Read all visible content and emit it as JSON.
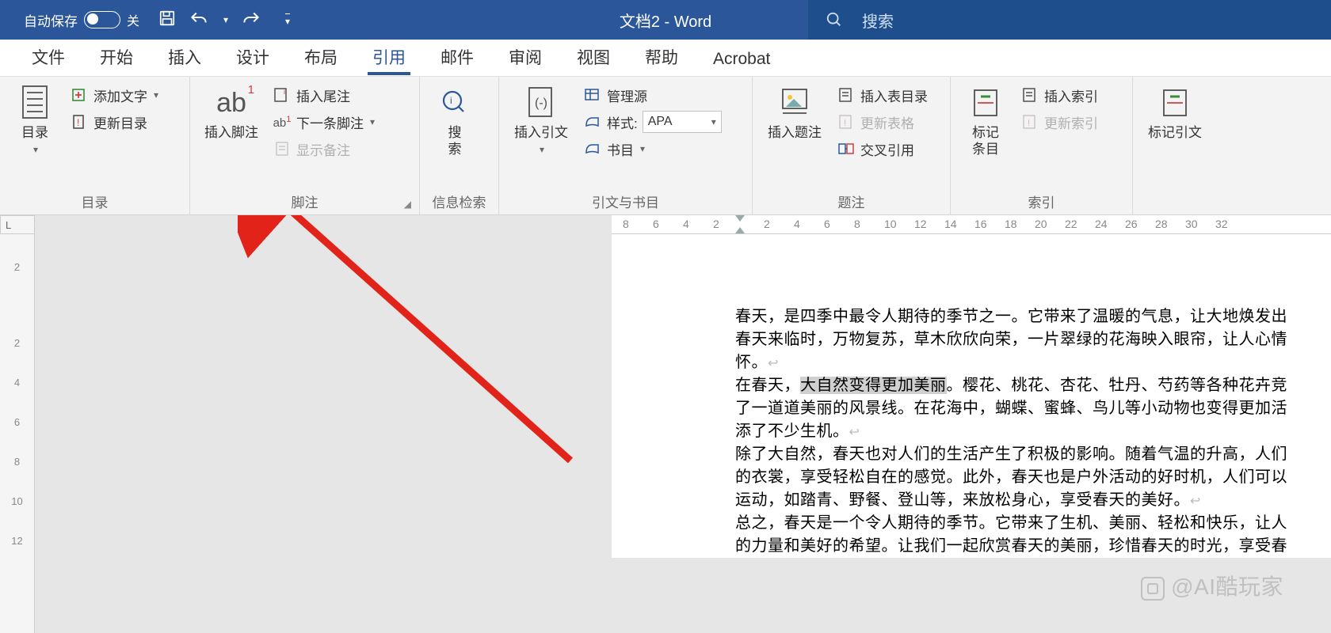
{
  "titlebar": {
    "autosave": "自动保存",
    "toggle_state": "关",
    "doc_title": "文档2  -  Word",
    "search_placeholder": "搜索"
  },
  "tabs": [
    "文件",
    "开始",
    "插入",
    "设计",
    "布局",
    "引用",
    "邮件",
    "审阅",
    "视图",
    "帮助",
    "Acrobat"
  ],
  "active_tab_index": 5,
  "ribbon": {
    "groups": [
      {
        "label": "目录",
        "big": [
          {
            "label": "目录",
            "icon": "toc-icon",
            "drop": true
          }
        ],
        "small": [
          {
            "label": "添加文字",
            "icon": "add-text-icon",
            "drop": true
          },
          {
            "label": "更新目录",
            "icon": "update-toc-icon"
          }
        ]
      },
      {
        "label": "脚注",
        "launcher": true,
        "big": [
          {
            "label": "插入脚注",
            "icon": "footnote-icon"
          }
        ],
        "small": [
          {
            "label": "插入尾注",
            "icon": "endnote-icon"
          },
          {
            "label": "下一条脚注",
            "icon": "next-footnote-icon",
            "drop": true
          },
          {
            "label": "显示备注",
            "icon": "show-notes-icon",
            "disabled": true
          }
        ]
      },
      {
        "label": "信息检索",
        "big": [
          {
            "label": "搜\n索",
            "icon": "search-icon"
          }
        ]
      },
      {
        "label": "引文与书目",
        "big": [
          {
            "label": "插入引文",
            "icon": "citation-icon",
            "drop": true
          }
        ],
        "small": [
          {
            "label": "管理源",
            "icon": "manage-sources-icon"
          },
          {
            "label": "样式:",
            "icon": "style-icon",
            "select": "APA"
          },
          {
            "label": "书目",
            "icon": "bibliography-icon",
            "drop": true
          }
        ]
      },
      {
        "label": "题注",
        "big": [
          {
            "label": "插入题注",
            "icon": "caption-icon"
          }
        ],
        "small": [
          {
            "label": "插入表目录",
            "icon": "table-of-figures-icon"
          },
          {
            "label": "更新表格",
            "icon": "update-table-icon",
            "disabled": true
          },
          {
            "label": "交叉引用",
            "icon": "cross-ref-icon"
          }
        ]
      },
      {
        "label": "索引",
        "big": [
          {
            "label": "标记\n条目",
            "icon": "mark-entry-icon"
          }
        ],
        "small": [
          {
            "label": "插入索引",
            "icon": "insert-index-icon"
          },
          {
            "label": "更新索引",
            "icon": "update-index-icon",
            "disabled": true
          }
        ]
      },
      {
        "label": "",
        "big": [
          {
            "label": "标记引文",
            "icon": "mark-citation-icon"
          }
        ]
      }
    ]
  },
  "hruler_left": [
    "8",
    "6",
    "4",
    "2"
  ],
  "hruler_right": [
    "2",
    "4",
    "6",
    "8",
    "10",
    "12",
    "14",
    "16",
    "18",
    "20",
    "22",
    "24",
    "26",
    "28",
    "30",
    "32"
  ],
  "vruler": [
    "2",
    "",
    "2",
    "4",
    "6",
    "8",
    "10",
    "12"
  ],
  "document": {
    "p1_a": "春天，是四季中最令人期待的季节之一。它带来了温暖的气息，让大地焕发出",
    "p1_b": "春天来临时，万物复苏，草木欣欣向荣，一片翠绿的花海映入眼帘，让人心情",
    "p1_c": "怀。",
    "p2_a_pre": "在春天，",
    "p2_a_hl": "大自然变得更加美丽",
    "p2_a_post": "。樱花、桃花、杏花、牡丹、芍药等各种花卉竞",
    "p2_b": "了一道道美丽的风景线。在花海中，蝴蝶、蜜蜂、鸟儿等小动物也变得更加活",
    "p2_c": "添了不少生机。",
    "p3_a": "除了大自然，春天也对人们的生活产生了积极的影响。随着气温的升高，人们",
    "p3_b": "的衣裳，享受轻松自在的感觉。此外，春天也是户外活动的好时机，人们可以",
    "p3_c": "运动，如踏青、野餐、登山等，来放松身心，享受春天的美好。",
    "p4_a": "总之，春天是一个令人期待的季节。它带来了生机、美丽、轻松和快乐，让人",
    "p4_b": "的力量和美好的希望。让我们一起欣赏春天的美丽，珍惜春天的时光，享受春"
  },
  "watermark": "@AI酷玩家"
}
